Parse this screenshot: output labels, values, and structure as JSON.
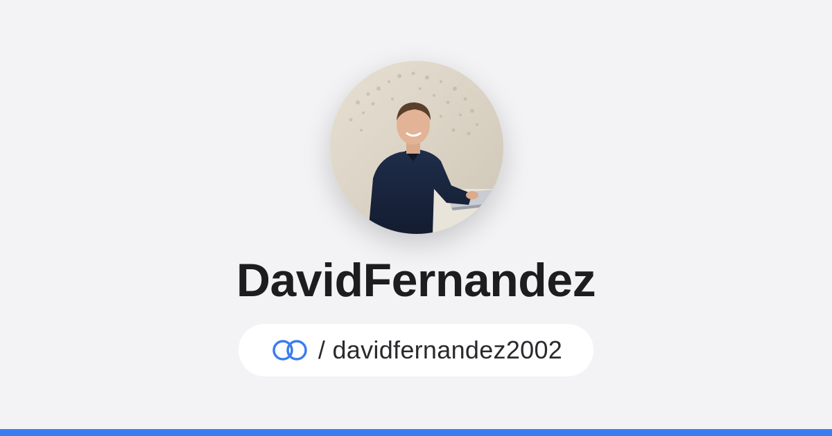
{
  "profile": {
    "display_name": "DavidFernandez",
    "handle": "/ davidfernandez2002",
    "avatar_alt": "profile photo"
  },
  "icons": {
    "link": "link-rings-icon"
  },
  "colors": {
    "background": "#f3f3f5",
    "accent": "#3b7cf0",
    "name_text": "#1d1d1f",
    "pill_background": "#ffffff"
  }
}
